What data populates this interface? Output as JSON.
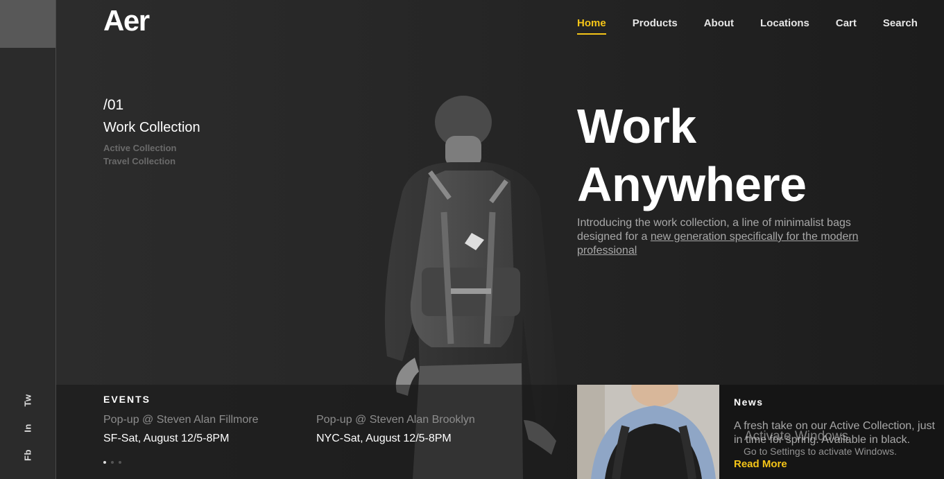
{
  "brand": {
    "logo": "Aer"
  },
  "nav": {
    "items": [
      {
        "label": "Home",
        "active": true
      },
      {
        "label": "Products"
      },
      {
        "label": "About"
      },
      {
        "label": "Locations"
      },
      {
        "label": "Cart"
      },
      {
        "label": "Search"
      }
    ]
  },
  "social": {
    "items": [
      "Tw",
      "In",
      "Fb"
    ]
  },
  "collection": {
    "number": "/01",
    "title": "Work Collection",
    "links": [
      "Active Collection",
      "Travel Collection"
    ]
  },
  "hero": {
    "headline_line1": "Work",
    "headline_line2": "Anywhere",
    "intro_plain": "Introducing the work collection, a line of minimalist bags designed for a ",
    "intro_link": "new generation specifically for the modern professional"
  },
  "events": {
    "heading": "EVENTS",
    "items": [
      {
        "name": "Pop-up @ Steven Alan Fillmore",
        "when": "SF-Sat, August 12/5-8PM"
      },
      {
        "name": "Pop-up @ Steven Alan Brooklyn",
        "when": "NYC-Sat, August 12/5-8PM"
      }
    ],
    "slides": 3,
    "active_slide": 1
  },
  "news": {
    "heading": "News",
    "text": "A fresh take on our Active Collection, just in time for spring. Available in black.",
    "read_more": "Read More"
  },
  "os_overlay": {
    "title": "Activate Windows",
    "subtitle": "Go to Settings to activate Windows."
  },
  "colors": {
    "accent": "#f5c518",
    "background": "#262626"
  }
}
